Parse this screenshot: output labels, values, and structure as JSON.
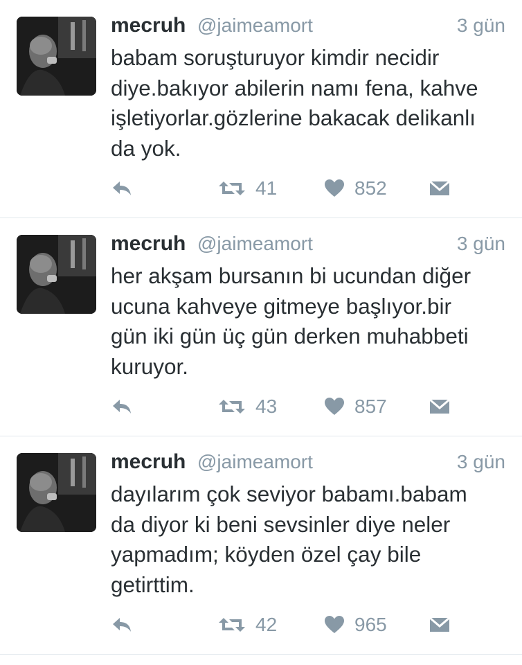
{
  "tweets": [
    {
      "name": "mecruh",
      "handle": "@jaimeamort",
      "time": "3 gün",
      "text": "babam soruşturuyor kimdir necidir\ndiye.bakıyor abilerin namı fena, kahve\nişletiyorlar.gözlerine bakacak delikanlı\nda yok.",
      "retweets": "41",
      "likes": "852"
    },
    {
      "name": "mecruh",
      "handle": "@jaimeamort",
      "time": "3 gün",
      "text": "her akşam bursanın bi ucundan diğer\nucuna kahveye gitmeye başlıyor.bir\ngün iki gün üç gün derken muhabbeti\nkuruyor.",
      "retweets": "43",
      "likes": "857"
    },
    {
      "name": "mecruh",
      "handle": "@jaimeamort",
      "time": "3 gün",
      "text": "dayılarım çok seviyor babamı.babam\nda diyor ki beni sevsinler diye neler\nyapmadım; köyden özel çay bile\ngetirttim.",
      "retweets": "42",
      "likes": "965"
    }
  ],
  "icons": {
    "reply": "reply-icon",
    "retweet": "retweet-icon",
    "like": "heart-icon",
    "message": "envelope-icon"
  },
  "colors": {
    "text": "#292f33",
    "muted": "#8899a6",
    "divider": "#e1e8ed"
  }
}
